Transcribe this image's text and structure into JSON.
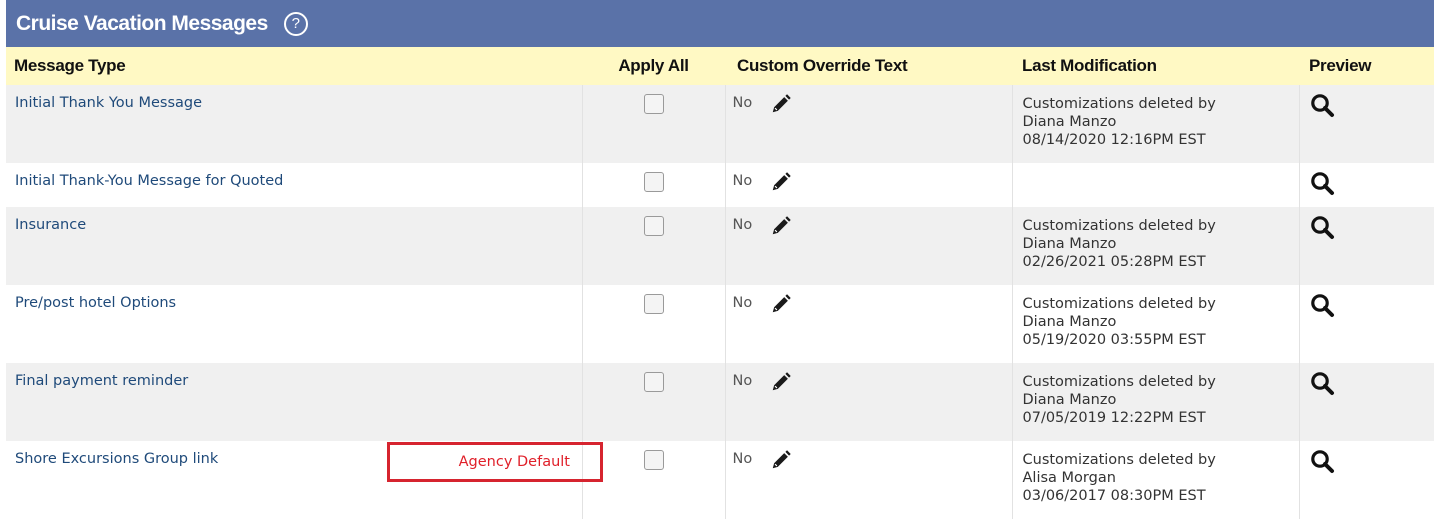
{
  "panel": {
    "title": "Cruise Vacation Messages",
    "help_icon": "?"
  },
  "columns": {
    "message_type": "Message Type",
    "apply_all": "Apply All",
    "custom_override": "Custom Override Text",
    "last_modification": "Last Modification",
    "preview": "Preview"
  },
  "rows": [
    {
      "message": "Initial Thank You Message",
      "override": "No",
      "mod_line1": "Customizations deleted by",
      "mod_line2": "Diana Manzo",
      "mod_line3": "08/14/2020 12:16PM EST"
    },
    {
      "message": "Initial Thank-You Message for Quoted",
      "override": "No",
      "mod_line1": "",
      "mod_line2": "",
      "mod_line3": ""
    },
    {
      "message": "Insurance",
      "override": "No",
      "mod_line1": "Customizations deleted by",
      "mod_line2": "Diana Manzo",
      "mod_line3": "02/26/2021 05:28PM EST"
    },
    {
      "message": "Pre/post hotel Options",
      "override": "No",
      "mod_line1": "Customizations deleted by",
      "mod_line2": "Diana Manzo",
      "mod_line3": "05/19/2020 03:55PM EST"
    },
    {
      "message": "Final payment reminder",
      "override": "No",
      "mod_line1": "Customizations deleted by",
      "mod_line2": "Diana Manzo",
      "mod_line3": "07/05/2019 12:22PM EST"
    },
    {
      "message": "Shore Excursions Group link",
      "badge": "Agency Default",
      "override": "No",
      "mod_line1": "Customizations deleted by",
      "mod_line2": "Alisa Morgan",
      "mod_line3": "03/06/2017 08:30PM EST"
    }
  ],
  "icons": {
    "edit": "pencil-icon",
    "preview": "magnifier-icon",
    "help": "help-circle-icon"
  },
  "colors": {
    "header_bg": "#5a72a8",
    "column_header_bg": "#fff9c4",
    "badge_red": "#d6242f",
    "link_blue": "#1f4a7a"
  }
}
